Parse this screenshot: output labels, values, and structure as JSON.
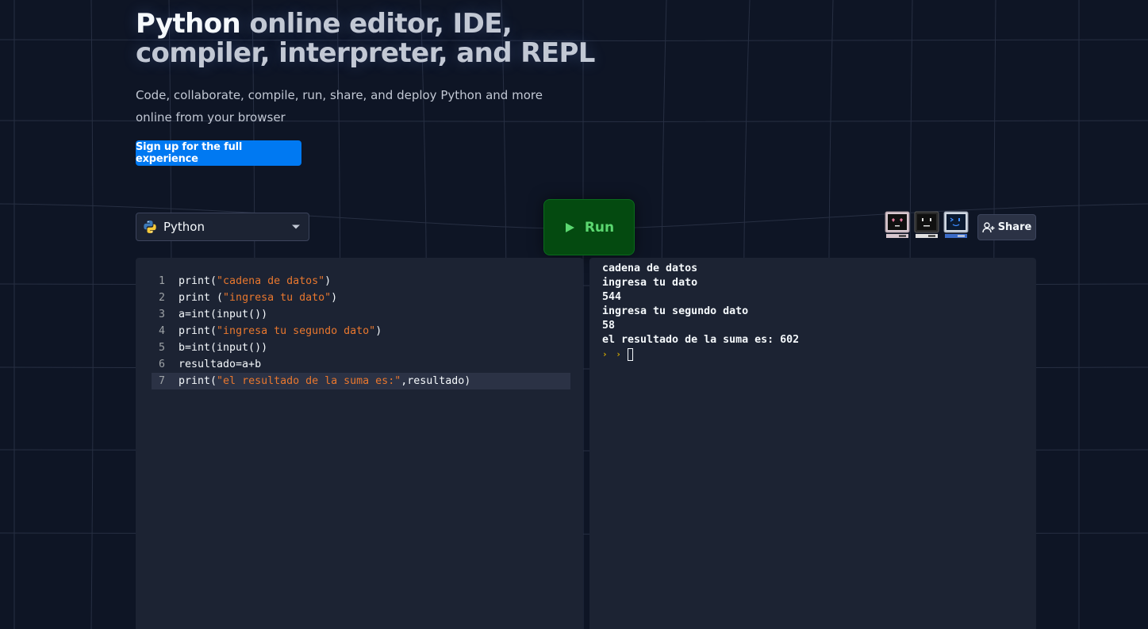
{
  "hero": {
    "title_highlight": "Python",
    "title_rest": " online editor, IDE, compiler, interpreter, and REPL",
    "subtitle": "Code, collaborate, compile, run, share, and deploy Python and more online from your browser",
    "signup_label": "Sign up for the full experience"
  },
  "toolbar": {
    "language": "Python",
    "run_label": "Run",
    "share_label": "Share",
    "avatars": [
      "love-eyes-monitor",
      "neutral-face-monitor",
      "code-face-monitor"
    ]
  },
  "editor": {
    "lines": [
      {
        "num": "1",
        "parts": [
          {
            "t": "print(",
            "s": false
          },
          {
            "t": "\"cadena de datos\"",
            "s": true
          },
          {
            "t": ")",
            "s": false
          }
        ]
      },
      {
        "num": "2",
        "parts": [
          {
            "t": "print (",
            "s": false
          },
          {
            "t": "\"ingresa tu dato\"",
            "s": true
          },
          {
            "t": ")",
            "s": false
          }
        ]
      },
      {
        "num": "3",
        "parts": [
          {
            "t": "a=int(input())",
            "s": false
          }
        ]
      },
      {
        "num": "4",
        "parts": [
          {
            "t": "print(",
            "s": false
          },
          {
            "t": "\"ingresa tu segundo dato\"",
            "s": true
          },
          {
            "t": ")",
            "s": false
          }
        ]
      },
      {
        "num": "5",
        "parts": [
          {
            "t": "b=int(input())",
            "s": false
          }
        ]
      },
      {
        "num": "6",
        "parts": [
          {
            "t": "resultado=a+b",
            "s": false
          }
        ]
      },
      {
        "num": "7",
        "parts": [
          {
            "t": "print(",
            "s": false
          },
          {
            "t": "\"el resultado de la suma es:\"",
            "s": true
          },
          {
            "t": ",resultado)",
            "s": false
          }
        ]
      }
    ],
    "active_line": 7
  },
  "console": {
    "lines": [
      "cadena de datos",
      "ingresa tu dato",
      "544",
      "ingresa tu segundo dato",
      "58",
      "el resultado de la suma es: 602"
    ]
  },
  "colors": {
    "background": "#0e1525",
    "panel": "#1c2333",
    "accent_blue": "#0079f2",
    "run_green": "#044a10",
    "string": "#e8772e"
  }
}
